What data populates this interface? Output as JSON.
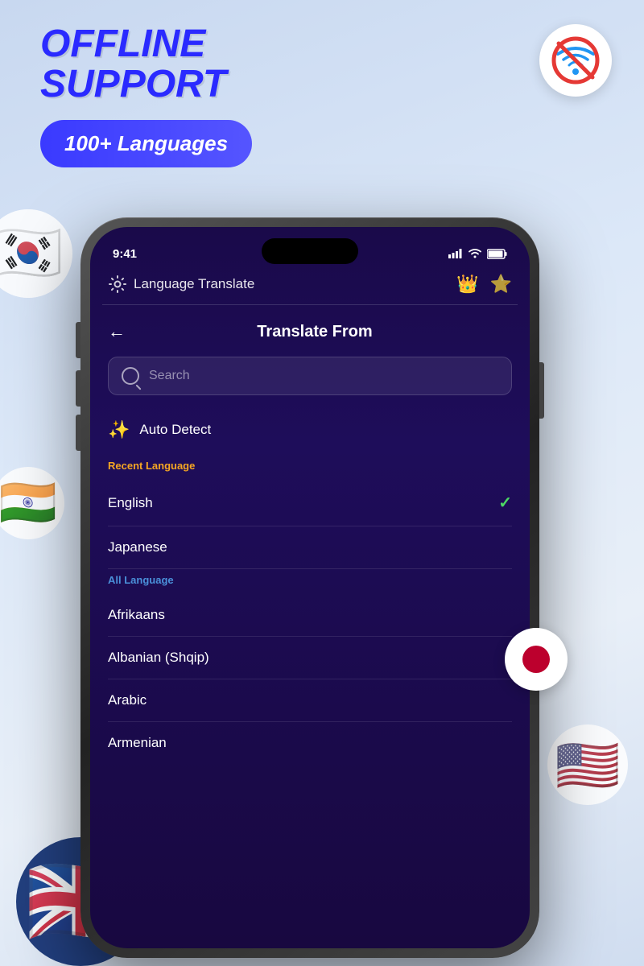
{
  "background": {
    "gradient_start": "#c8d8f0",
    "gradient_end": "#d0ddf0"
  },
  "header": {
    "offline_line1": "OFFLINE",
    "offline_line2": "SUPPORT",
    "languages_badge": "100+ Languages",
    "accent_color": "#2a2aff",
    "badge_color": "#3a3aff"
  },
  "no_wifi": {
    "icon": "no-wifi-icon"
  },
  "phone": {
    "status_bar": {
      "time": "9:41",
      "signal": "signal-icon",
      "wifi": "wifi-icon",
      "battery": "battery-icon"
    },
    "app_header": {
      "settings_icon": "settings-gear-icon",
      "title": "Language Translate",
      "crown_icon": "crown-icon",
      "star_icon": "star-icon"
    },
    "screen": {
      "page_title": "Translate From",
      "back_label": "←",
      "search_placeholder": "Search",
      "auto_detect_label": "Auto Detect",
      "auto_detect_icon": "sparkle-icon",
      "recent_section_label": "Recent Language",
      "all_section_label": "All Language",
      "languages": [
        {
          "name": "English",
          "selected": true
        },
        {
          "name": "Japanese",
          "selected": false
        }
      ],
      "all_languages": [
        {
          "name": "Afrikaans",
          "selected": false
        },
        {
          "name": "Albanian (Shqip)",
          "selected": false
        },
        {
          "name": "Arabic",
          "selected": false
        },
        {
          "name": "Armenian",
          "selected": false
        }
      ],
      "checkmark_color": "#4cd964",
      "recent_label_color": "#f5a623",
      "all_label_color": "#4a90d9"
    }
  }
}
